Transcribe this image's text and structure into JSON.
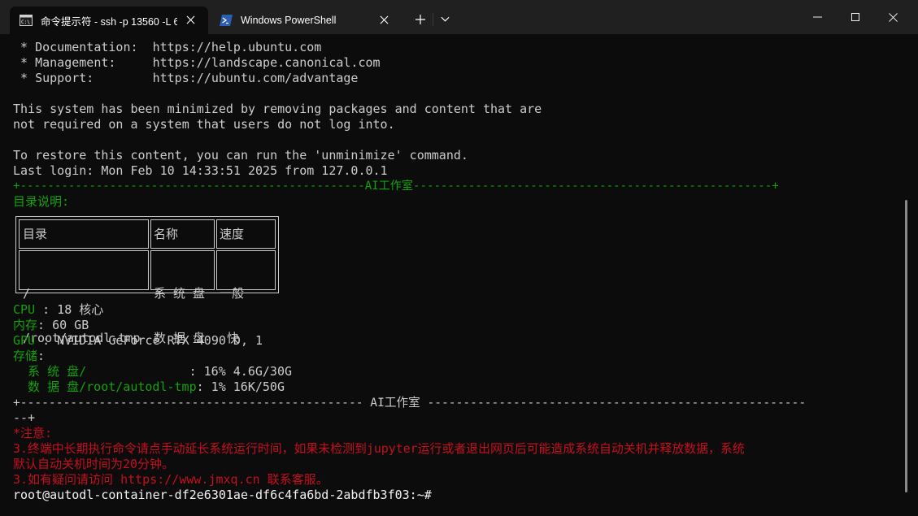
{
  "tabs": [
    {
      "label": "命令提示符 - ssh  -p 13560 -L 6",
      "icon": "cmd-icon",
      "active": true
    },
    {
      "label": "Windows PowerShell",
      "icon": "powershell-icon",
      "active": false
    }
  ],
  "terminal": {
    "motd": [
      " * Documentation:  https://help.ubuntu.com",
      " * Management:     https://landscape.canonical.com",
      " * Support:        https://ubuntu.com/advantage",
      "",
      "This system has been minimized by removing packages and content that are",
      "not required on a system that users do not log into.",
      "",
      "To restore this content, you can run the 'unminimize' command.",
      "Last login: Mon Feb 10 14:33:51 2025 from 127.0.0.1"
    ],
    "banner_top": "+--------------------------------------------------AI工作室----------------------------------------------------+",
    "dir_heading": "目录说明:",
    "table": {
      "headers": [
        "目录",
        "名称",
        "速度"
      ],
      "rows": [
        {
          "path": "/",
          "name": "系 统 盘",
          "speed": "一般"
        },
        {
          "path": "/root/autodl-tmp",
          "name": "数 据 盘",
          "speed": " 快"
        }
      ]
    },
    "specs": {
      "cpu_label": "CPU",
      "cpu_value": " : 18 核心",
      "mem_label": "内存",
      "mem_value": ": 60 GB",
      "gpu_label": "GPU",
      "gpu_value": " : NVIDIA GeForce RTX 4090 D, 1",
      "storage_label": "存储",
      "storage_value": ":",
      "sys_disk_label": "  系 统 盘/              ",
      "sys_disk_value": ": 16% 4.6G/30G",
      "data_disk_label": "  数 据 盘/root/autodl-tmp",
      "data_disk_value": ": 1% 16K/50G"
    },
    "banner_bottom": "+------------------------------------------------ AI工作室 -----------------------------------------------------",
    "banner_bottom_cont": "--+",
    "notice_title": "*注意:",
    "notice_1": "3.终端中长期执行命令请点手动延长系统运行时间，如果未检测到jupyter运行或者退出网页后可能造成系统自动关机并释放数据，系统",
    "notice_1_cont": "默认自动关机时间为20分钟。",
    "notice_2": "3.如有疑问请访问 https://www.jmxq.cn 联系客服。",
    "prompt": "root@autodl-container-df2e6301ae-df6c4fa6bd-2abdfb3f03:~#"
  },
  "colors": {
    "green": "#13a10e",
    "red": "#c50f1f",
    "background": "#0c0c0c",
    "foreground": "#cccccc"
  }
}
